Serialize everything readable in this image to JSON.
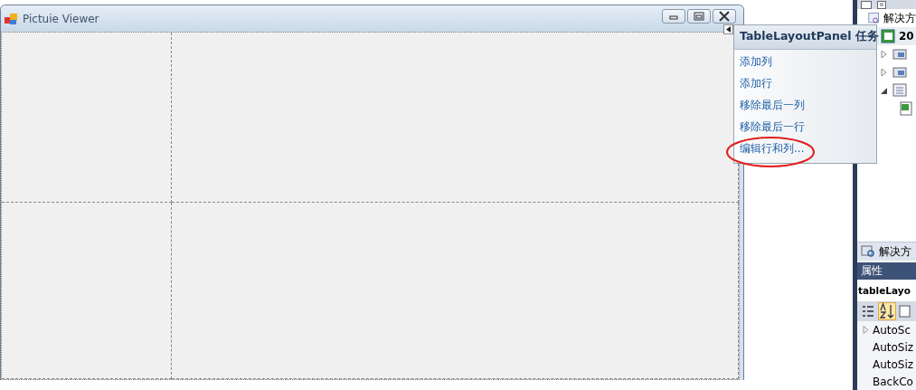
{
  "window": {
    "title": "Pictuie Viewer"
  },
  "smart_tag": {
    "title": "TableLayoutPanel 任务",
    "items": [
      {
        "label": "添加列",
        "highlighted": false
      },
      {
        "label": "添加行",
        "highlighted": false
      },
      {
        "label": "移除最后一列",
        "highlighted": false
      },
      {
        "label": "移除最后一行",
        "highlighted": false
      },
      {
        "label": "编辑行和列...",
        "highlighted": true
      }
    ]
  },
  "solution_explorer": {
    "header": "解决方",
    "project": "20",
    "nodes": [
      {
        "kind": "folder",
        "expanded": false
      },
      {
        "kind": "folder",
        "expanded": false
      },
      {
        "kind": "form",
        "expanded": true,
        "children": [
          {
            "kind": "file"
          }
        ]
      }
    ],
    "tab": "解决方"
  },
  "properties": {
    "title": "属性",
    "object": "tableLayo",
    "rows": [
      {
        "kind": "group",
        "name": "AutoSc"
      },
      {
        "kind": "property",
        "name": "AutoSiz"
      },
      {
        "kind": "property",
        "name": "AutoSiz"
      },
      {
        "kind": "property",
        "name": "BackCo"
      }
    ]
  }
}
